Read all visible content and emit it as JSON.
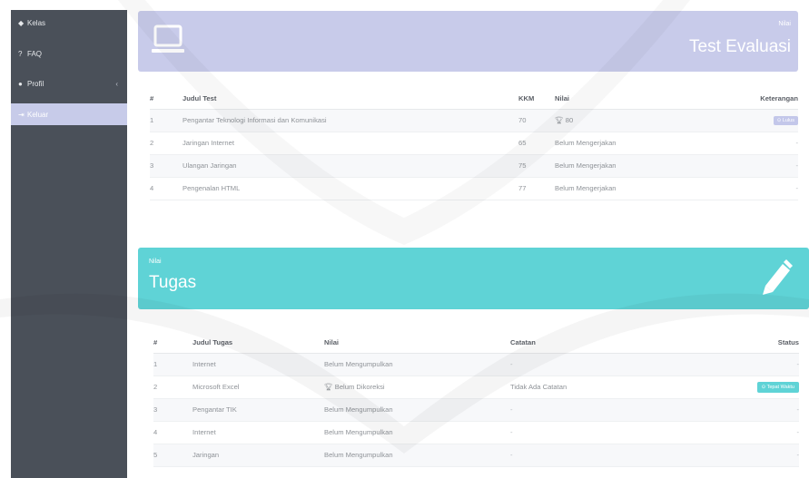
{
  "sidebar": {
    "items": [
      {
        "label": "Kelas",
        "icon": "graduation-cap-icon",
        "glyph": "🎓"
      },
      {
        "label": "FAQ",
        "icon": "question-icon",
        "glyph": "?"
      },
      {
        "label": "Profil",
        "icon": "user-icon",
        "glyph": "👤",
        "chevron": "‹"
      },
      {
        "label": "Keluar",
        "icon": "logout-icon",
        "glyph": "⇥"
      }
    ]
  },
  "evaluasi": {
    "small_label": "Nilai",
    "title": "Test Evaluasi",
    "icon": "laptop-icon",
    "columns": [
      "#",
      "Judul Test",
      "KKM",
      "Nilai",
      "Keterangan"
    ],
    "rows": [
      {
        "no": "1",
        "judul": "Pengantar Teknologi Informasi dan Komunikasi",
        "kkm": "70",
        "nilai": "80",
        "nilai_icon": "trophy-icon",
        "keterangan": "Lulus",
        "badge": true
      },
      {
        "no": "2",
        "judul": "Jaringan Internet",
        "kkm": "65",
        "nilai": "Belum Mengerjakan",
        "keterangan": "-"
      },
      {
        "no": "3",
        "judul": "Ulangan Jaringan",
        "kkm": "75",
        "nilai": "Belum Mengerjakan",
        "keterangan": "-"
      },
      {
        "no": "4",
        "judul": "Pengenalan HTML",
        "kkm": "77",
        "nilai": "Belum Mengerjakan",
        "keterangan": "-"
      }
    ]
  },
  "tugas": {
    "small_label": "Nilai",
    "title": "Tugas",
    "icon": "pencil-icon",
    "columns": [
      "#",
      "Judul Tugas",
      "Nilai",
      "Catatan",
      "Status"
    ],
    "rows": [
      {
        "no": "1",
        "judul": "Internet",
        "nilai": "Belum Mengumpulkan",
        "catatan": "-",
        "status": "-"
      },
      {
        "no": "2",
        "judul": "Microsoft Excel",
        "nilai": "Belum Dikoreksi",
        "nilai_icon": "trophy-icon",
        "catatan": "Tidak Ada Catatan",
        "status": "Tepat Waktu",
        "badge": true
      },
      {
        "no": "3",
        "judul": "Pengantar TIK",
        "nilai": "Belum Mengumpulkan",
        "catatan": "-",
        "status": "-"
      },
      {
        "no": "4",
        "judul": "Internet",
        "nilai": "Belum Mengumpulkan",
        "catatan": "-",
        "status": "-"
      },
      {
        "no": "5",
        "judul": "Jaringan",
        "nilai": "Belum Mengumpulkan",
        "catatan": "-",
        "status": "-"
      }
    ]
  },
  "colors": {
    "sidebar_bg": "#4a5059",
    "active_item": "#c7cbe9",
    "purple_banner": "#c8cbea",
    "teal_banner": "#5fd3d6"
  }
}
